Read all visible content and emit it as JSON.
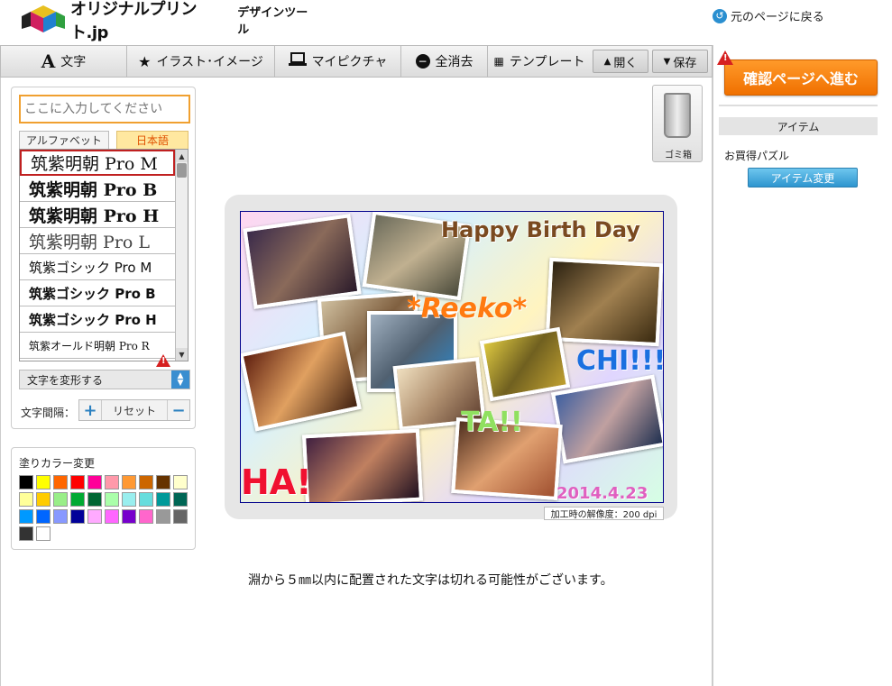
{
  "header": {
    "logo_text": "オリジナルプリント.jp",
    "logo_sub": "デザインツール",
    "back_link": "元のページに戻る"
  },
  "toolbar": {
    "text": "文字",
    "illust": "イラスト･イメージ",
    "mypicture": "マイピクチャ",
    "clear_all": "全消去",
    "template": "テンプレート",
    "open": "開く",
    "save": "保存"
  },
  "right_panel": {
    "confirm": "確認ページへ進む",
    "item_heading": "アイテム",
    "item_name": "お買得パズル",
    "item_change": "アイテム変更"
  },
  "text_panel": {
    "input_placeholder": "ここに入力してください",
    "tab_alphabet": "アルファベット",
    "tab_japanese": "日本語",
    "fonts": [
      "筑紫明朝 Pro M",
      "筑紫明朝 Pro B",
      "筑紫明朝 Pro H",
      "筑紫明朝 Pro L",
      "筑紫ゴシック Pro M",
      "筑紫ゴシック Pro B",
      "筑紫ゴシック Pro H",
      "筑紫オールド明朝 Pro R"
    ],
    "transform": "文字を変形する",
    "spacing_label": "文字間隔：",
    "spacing_reset": "リセット"
  },
  "color_panel": {
    "title": "塗りカラー変更",
    "swatches": [
      "#000000",
      "#ffff00",
      "#ff6600",
      "#ff0000",
      "#ff0099",
      "#ff99aa",
      "#ff9933",
      "#cc6600",
      "#663300",
      "#ffffcc",
      "#ffff99",
      "#ffcc00",
      "#99ee88",
      "#00aa33",
      "#006633",
      "#aaffaa",
      "#99eeee",
      "#66dddd",
      "#009999",
      "#006655",
      "#0099ff",
      "#0066ff",
      "#8899ff",
      "#000099",
      "#ffaaff",
      "#ff66ff",
      "#7700cc",
      "#ff66cc",
      "#999999",
      "#666666",
      "#333333",
      "#ffffff"
    ]
  },
  "trash_label": "ゴミ箱",
  "design": {
    "text_happy": "Happy Birth Day",
    "text_reeko": "*Reeko*",
    "text_chi": "CHI!!!",
    "text_ta": "TA!!",
    "text_ha": "HA!",
    "text_date": "2014.4.23"
  },
  "resolution_label": "加工時の解像度：200 dpi",
  "notice": "淵から５㎜以内に配置された文字は切れる可能性がございます。"
}
